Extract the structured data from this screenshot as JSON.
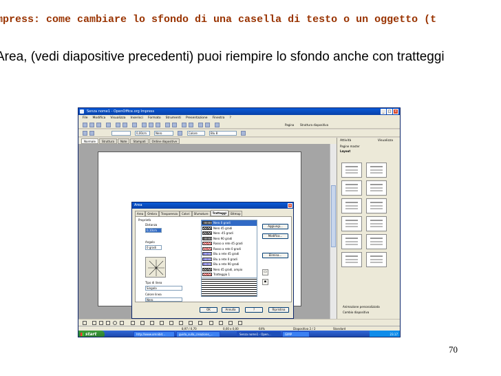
{
  "slide": {
    "title": "Impress: come cambiare lo sfondo di una casella di testo o un oggetto (t",
    "body": "Area, (vedi diapositive precedenti) puoi riempire lo sfondo anche con tratteggi",
    "page_number": "70"
  },
  "app": {
    "window_title": "Senza nome1 - OpenOffice.org Impress",
    "menu": [
      "File",
      "Modifica",
      "Visualizza",
      "Inserisci",
      "Formato",
      "Strumenti",
      "Presentazione",
      "Finestra",
      "?"
    ],
    "toolbar": {
      "page_btn": "Pagina",
      "layout_btn": "Struttura diapositiva",
      "line_width": "0,00cm",
      "line_color": "Nero",
      "fill_mode": "Colore",
      "fill_color": "Blu 8"
    },
    "view_tabs": [
      "Normale",
      "Struttura",
      "Note",
      "Stampati",
      "Ordine diapositive"
    ],
    "active_view_tab": "Normale"
  },
  "dialog": {
    "title": "Area",
    "tabs": [
      "Area",
      "Ombra",
      "Trasparenza",
      "Colori",
      "Sfumature",
      "Tratteggi",
      "Bitmap"
    ],
    "active_tab": "Tratteggi",
    "group_label": "Proprietà",
    "distance_label": "Distanza",
    "distance_value": "0,10cm",
    "angle_label": "Angolo",
    "angle_value": "0 gradi",
    "line_type_label": "Tipo di linea",
    "line_type_value": "Singola",
    "line_color_label": "Colore linea",
    "line_color_value": "Nero",
    "hatch_list": [
      "Nero 0 gradi",
      "Nero 45 gradi",
      "Nero -45 gradi",
      "Nero 90 gradi",
      "Rosso a rete 45 gradi",
      "Rosso a rete 0 gradi",
      "Blu a rete 45 gradi",
      "Blu a rete 0 gradi",
      "Blu a rete 90 gradi",
      "Nero 45 gradi, ampio",
      "Tratteggio 1"
    ],
    "selected_hatch": "Nero 0 gradi",
    "buttons": {
      "add": "Aggiungi...",
      "modify": "Modifica...",
      "delete": "Elimina...",
      "ok": "OK",
      "cancel": "Annulla",
      "help": "?",
      "reset": "Ripristina"
    }
  },
  "sidebar": {
    "title": "Attività",
    "view_label": "Visualizza",
    "sections": [
      "Pagine master",
      "Layout"
    ],
    "bottom_sections": [
      "Animazione personalizzata",
      "Cambio diapositiva"
    ]
  },
  "status": {
    "pos": "8,97 / 0,70",
    "size": "0,00 x 0,00",
    "zoom": "64%",
    "slide": "Diapositiva 2 / 2",
    "layout": "Standard"
  },
  "taskbar": {
    "start_label": "start",
    "tasks": [
      "http://www.omnibit...",
      "guida_sulla_creazione_...",
      "Senza nome1 - Open...",
      "GIMP"
    ],
    "active_task": "Senza nome1 - Open...",
    "clock": "23.17"
  }
}
